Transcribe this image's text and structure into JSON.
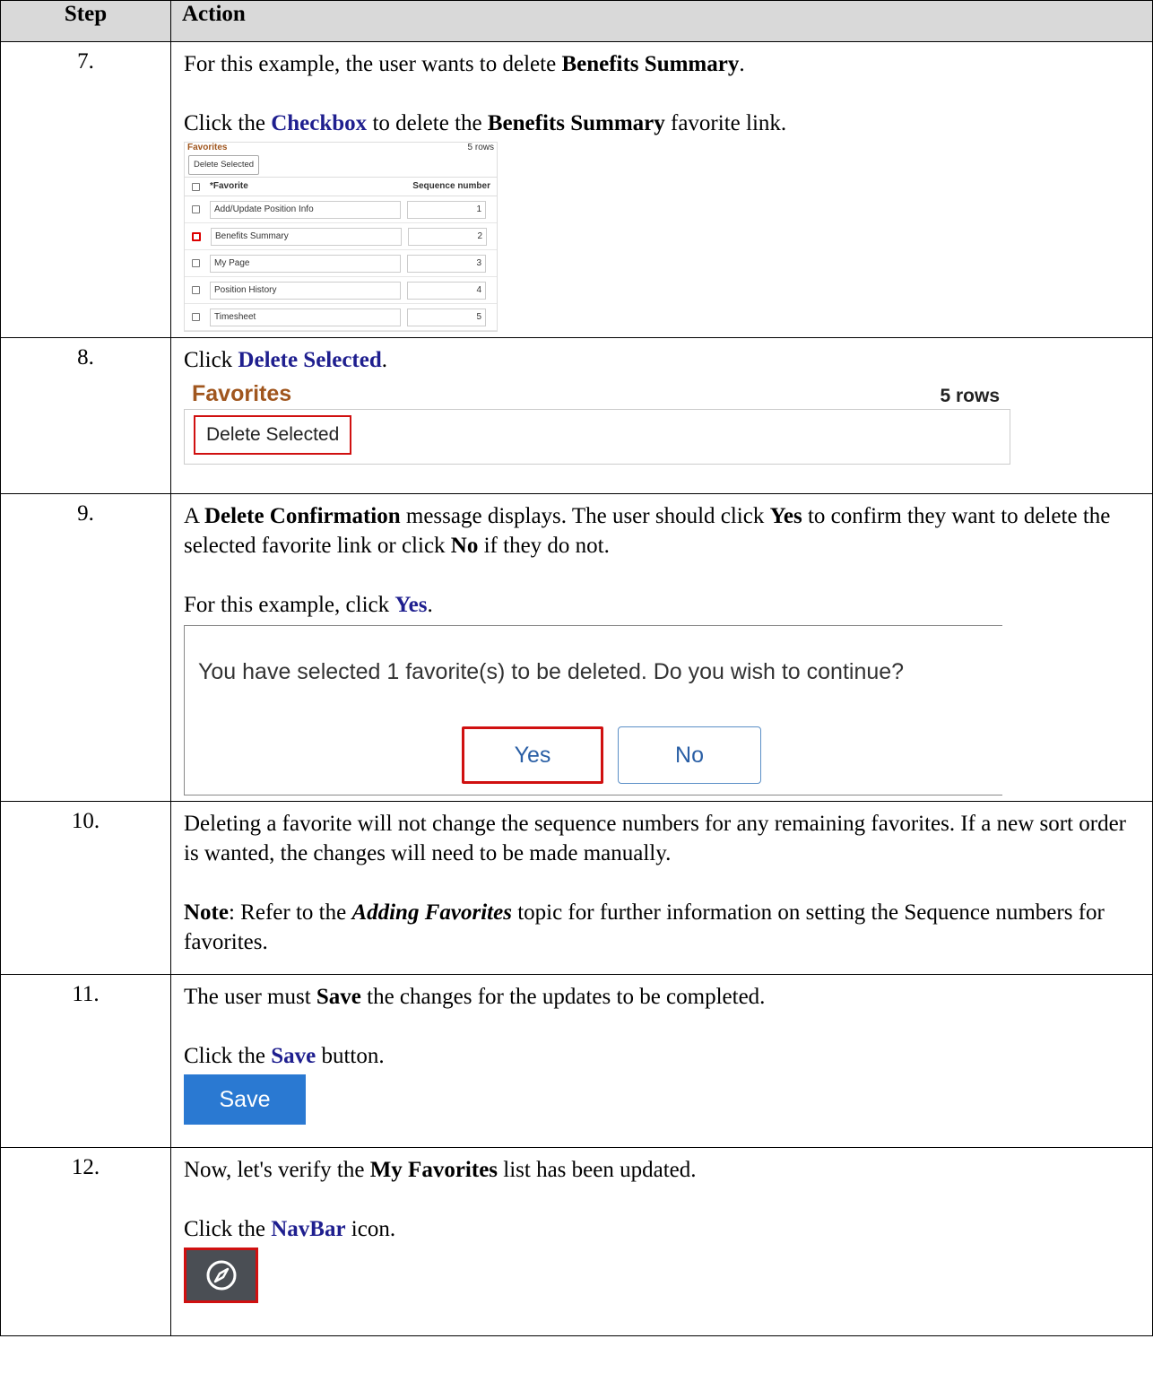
{
  "table": {
    "header_step": "Step",
    "header_action": "Action"
  },
  "step7": {
    "num": "7.",
    "line1_pre": "For this example, the user wants to delete ",
    "line1_bold": "Benefits Summary",
    "line1_post": ".",
    "line2_pre": "Click the ",
    "line2_link": "Checkbox",
    "line2_mid": " to delete the ",
    "line2_bold": "Benefits Summary",
    "line2_post": " favorite link."
  },
  "favsmall": {
    "title": "Favorites",
    "rows_count": "5 rows",
    "delete_button": "Delete Selected",
    "col_favorite": "*Favorite",
    "col_sequence": "Sequence number",
    "rows": [
      {
        "name": "Add/Update Position Info",
        "seq": "1"
      },
      {
        "name": "Benefits Summary",
        "seq": "2"
      },
      {
        "name": "My Page",
        "seq": "3"
      },
      {
        "name": "Position History",
        "seq": "4"
      },
      {
        "name": "Timesheet",
        "seq": "5"
      }
    ]
  },
  "step8": {
    "num": "8.",
    "pre": "Click ",
    "link": "Delete Selected",
    "post": "."
  },
  "favbig": {
    "title": "Favorites",
    "rows_count": "5 rows",
    "delete_button": "Delete Selected"
  },
  "step9": {
    "num": "9.",
    "p1_a": "A ",
    "p1_b": "Delete Confirmation",
    "p1_c": " message displays. The user should click ",
    "p1_d": "Yes",
    "p1_e": " to confirm they want to delete the selected favorite link or click ",
    "p1_f": "No",
    "p1_g": " if they do not.",
    "p2_pre": "For this example, click ",
    "p2_link": "Yes",
    "p2_post": "."
  },
  "dialog": {
    "message": "You have selected 1 favorite(s) to be deleted. Do you wish to continue?",
    "yes": "Yes",
    "no": "No"
  },
  "step10": {
    "num": "10.",
    "p1": "Deleting a favorite will not change the sequence numbers for any remaining favorites. If a new sort order is wanted, the changes will need to be made manually.",
    "note_label": "Note",
    "note_a": ": Refer to the ",
    "note_topic": "Adding Favorites",
    "note_b": " topic for further information on setting the Sequence numbers for favorites."
  },
  "step11": {
    "num": "11.",
    "p1_a": "The user must ",
    "p1_b": "Save",
    "p1_c": " the changes for the updates to be completed.",
    "p2_pre": "Click the ",
    "p2_link": "Save",
    "p2_post": " button.",
    "save_button": "Save"
  },
  "step12": {
    "num": "12.",
    "p1_a": "Now, let's verify the ",
    "p1_b": "My Favorites",
    "p1_c": " list has been updated.",
    "p2_pre": "Click the ",
    "p2_link": "NavBar",
    "p2_post": " icon.",
    "icon": "compass-icon"
  },
  "colors": {
    "header_bg": "#d9d9d9",
    "link_blue": "#1f1f8f",
    "highlight_red": "#d01010",
    "save_blue": "#2a79d2",
    "favorites_title": "#a0561e"
  }
}
